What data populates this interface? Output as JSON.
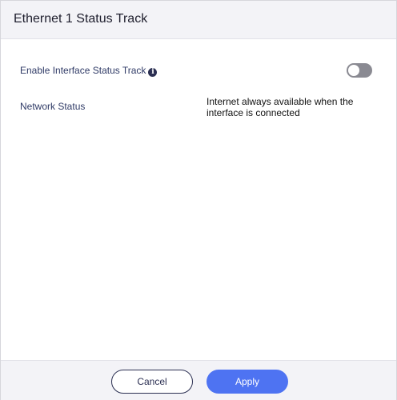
{
  "dialog": {
    "title": "Ethernet 1 Status Track"
  },
  "fields": {
    "enable_label": "Enable Interface Status Track",
    "info_glyph": "i",
    "enable_state": "off",
    "network_status_label": "Network Status",
    "network_status_value": "Internet always available when the interface is connected"
  },
  "footer": {
    "cancel_label": "Cancel",
    "apply_label": "Apply"
  },
  "colors": {
    "accent": "#4e73f2",
    "toggle_off": "#8a8a92",
    "header_bg": "#f3f3f7"
  }
}
